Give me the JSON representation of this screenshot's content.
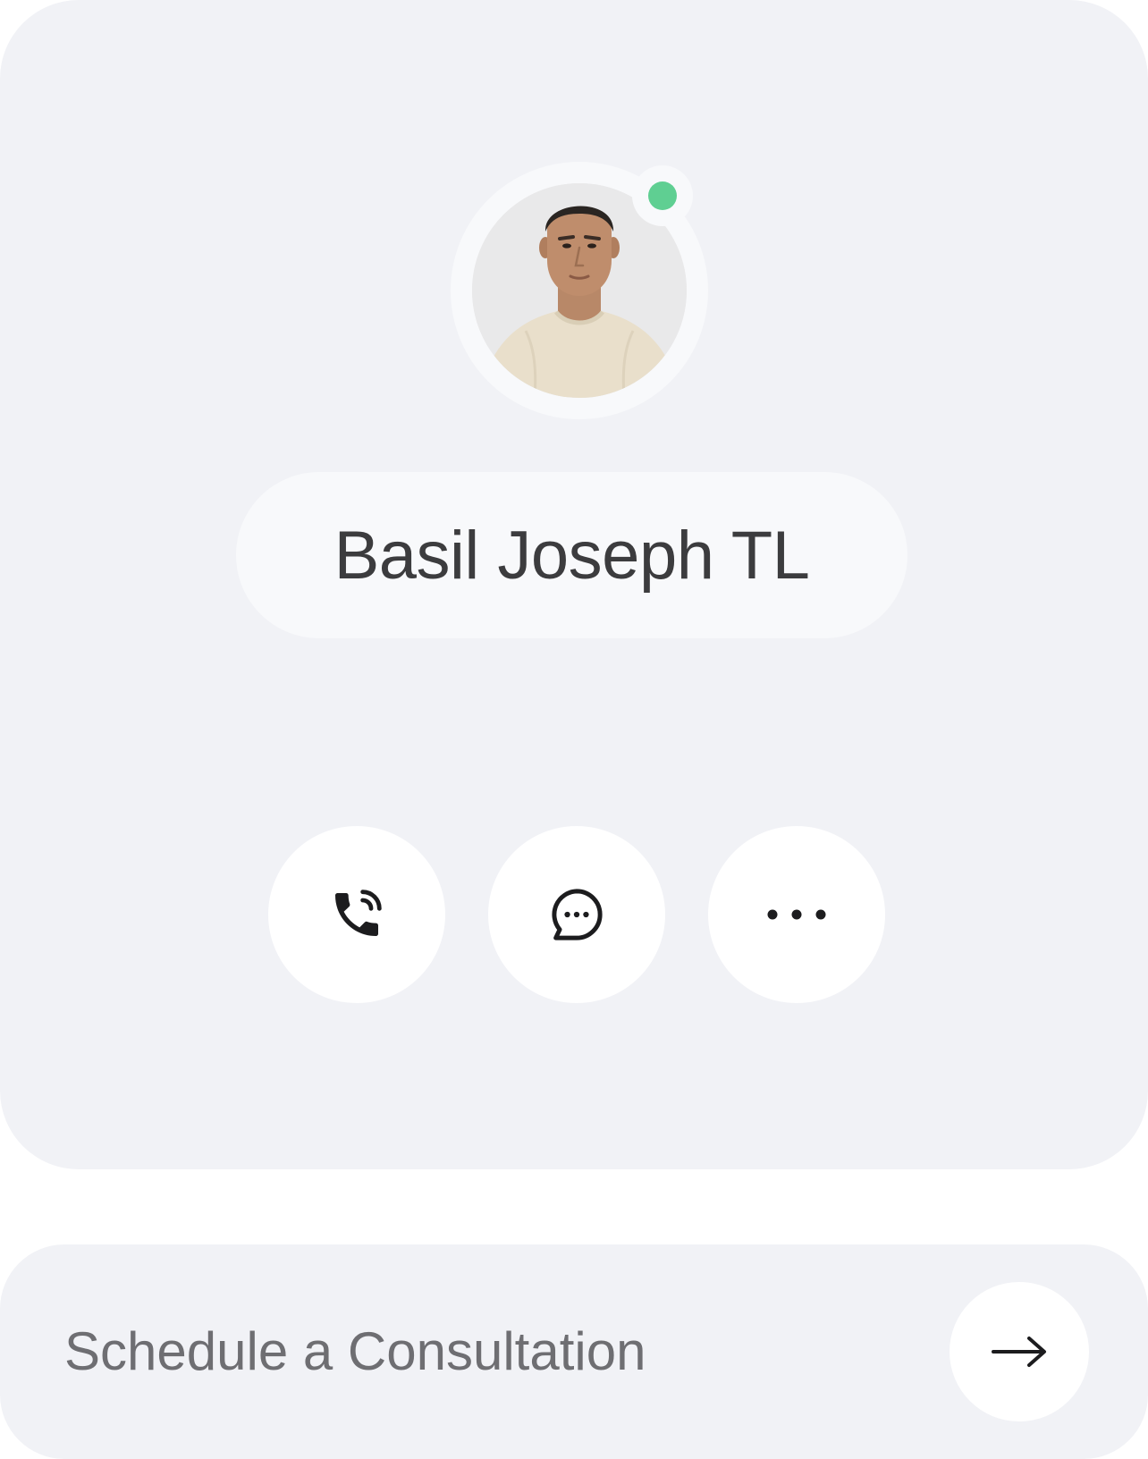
{
  "profile": {
    "name": "Basil Joseph TL",
    "status": "online",
    "status_color": "#5fcf92",
    "avatar_icon": "person-portrait"
  },
  "actions": [
    {
      "name": "call",
      "icon": "phone-ringing-icon"
    },
    {
      "name": "message",
      "icon": "chat-bubble-icon"
    },
    {
      "name": "more",
      "icon": "more-horizontal-icon"
    }
  ],
  "schedule": {
    "label": "Schedule a Consultation",
    "icon": "arrow-right-icon"
  },
  "colors": {
    "card_background": "#f1f2f6",
    "pill_background": "#f8f9fb",
    "button_background": "#ffffff",
    "name_text": "#3c3c3e",
    "schedule_text": "#6e6e72"
  }
}
